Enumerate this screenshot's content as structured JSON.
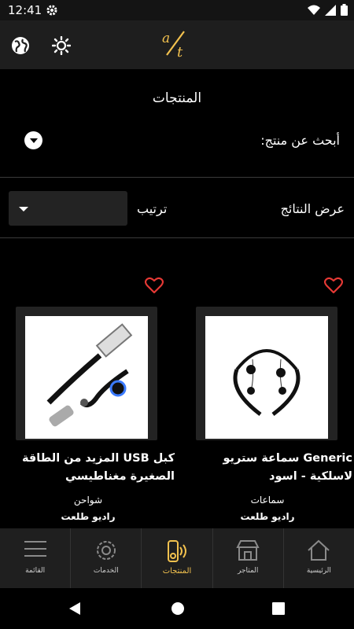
{
  "status": {
    "time": "12:41"
  },
  "header": {
    "logo": "a/t"
  },
  "page": {
    "title": "المنتجات"
  },
  "search": {
    "label": "أبحث عن منتج:"
  },
  "results": {
    "label": "عرض النتائج",
    "sort_label": "ترتيب",
    "sort_value": ""
  },
  "products": [
    {
      "name": "Generic سماعة ستريو لاسلكية - اسود",
      "category": "سماعات",
      "store": "راديو طلعت"
    },
    {
      "name": "كبل USB المزيد من الطاقة الصغيرة مغناطيسي",
      "category": "شواحن",
      "store": "راديو طلعت"
    }
  ],
  "nav": {
    "items": [
      {
        "label": "القائمة",
        "icon": "menu-icon"
      },
      {
        "label": "الخدمات",
        "icon": "services-icon"
      },
      {
        "label": "المنتجات",
        "icon": "products-icon",
        "active": true
      },
      {
        "label": "المتاجر",
        "icon": "store-icon"
      },
      {
        "label": "الرئيسية",
        "icon": "home-icon"
      }
    ]
  },
  "colors": {
    "accent": "#f2c14e",
    "heart": "#e53935",
    "background": "#000000"
  }
}
